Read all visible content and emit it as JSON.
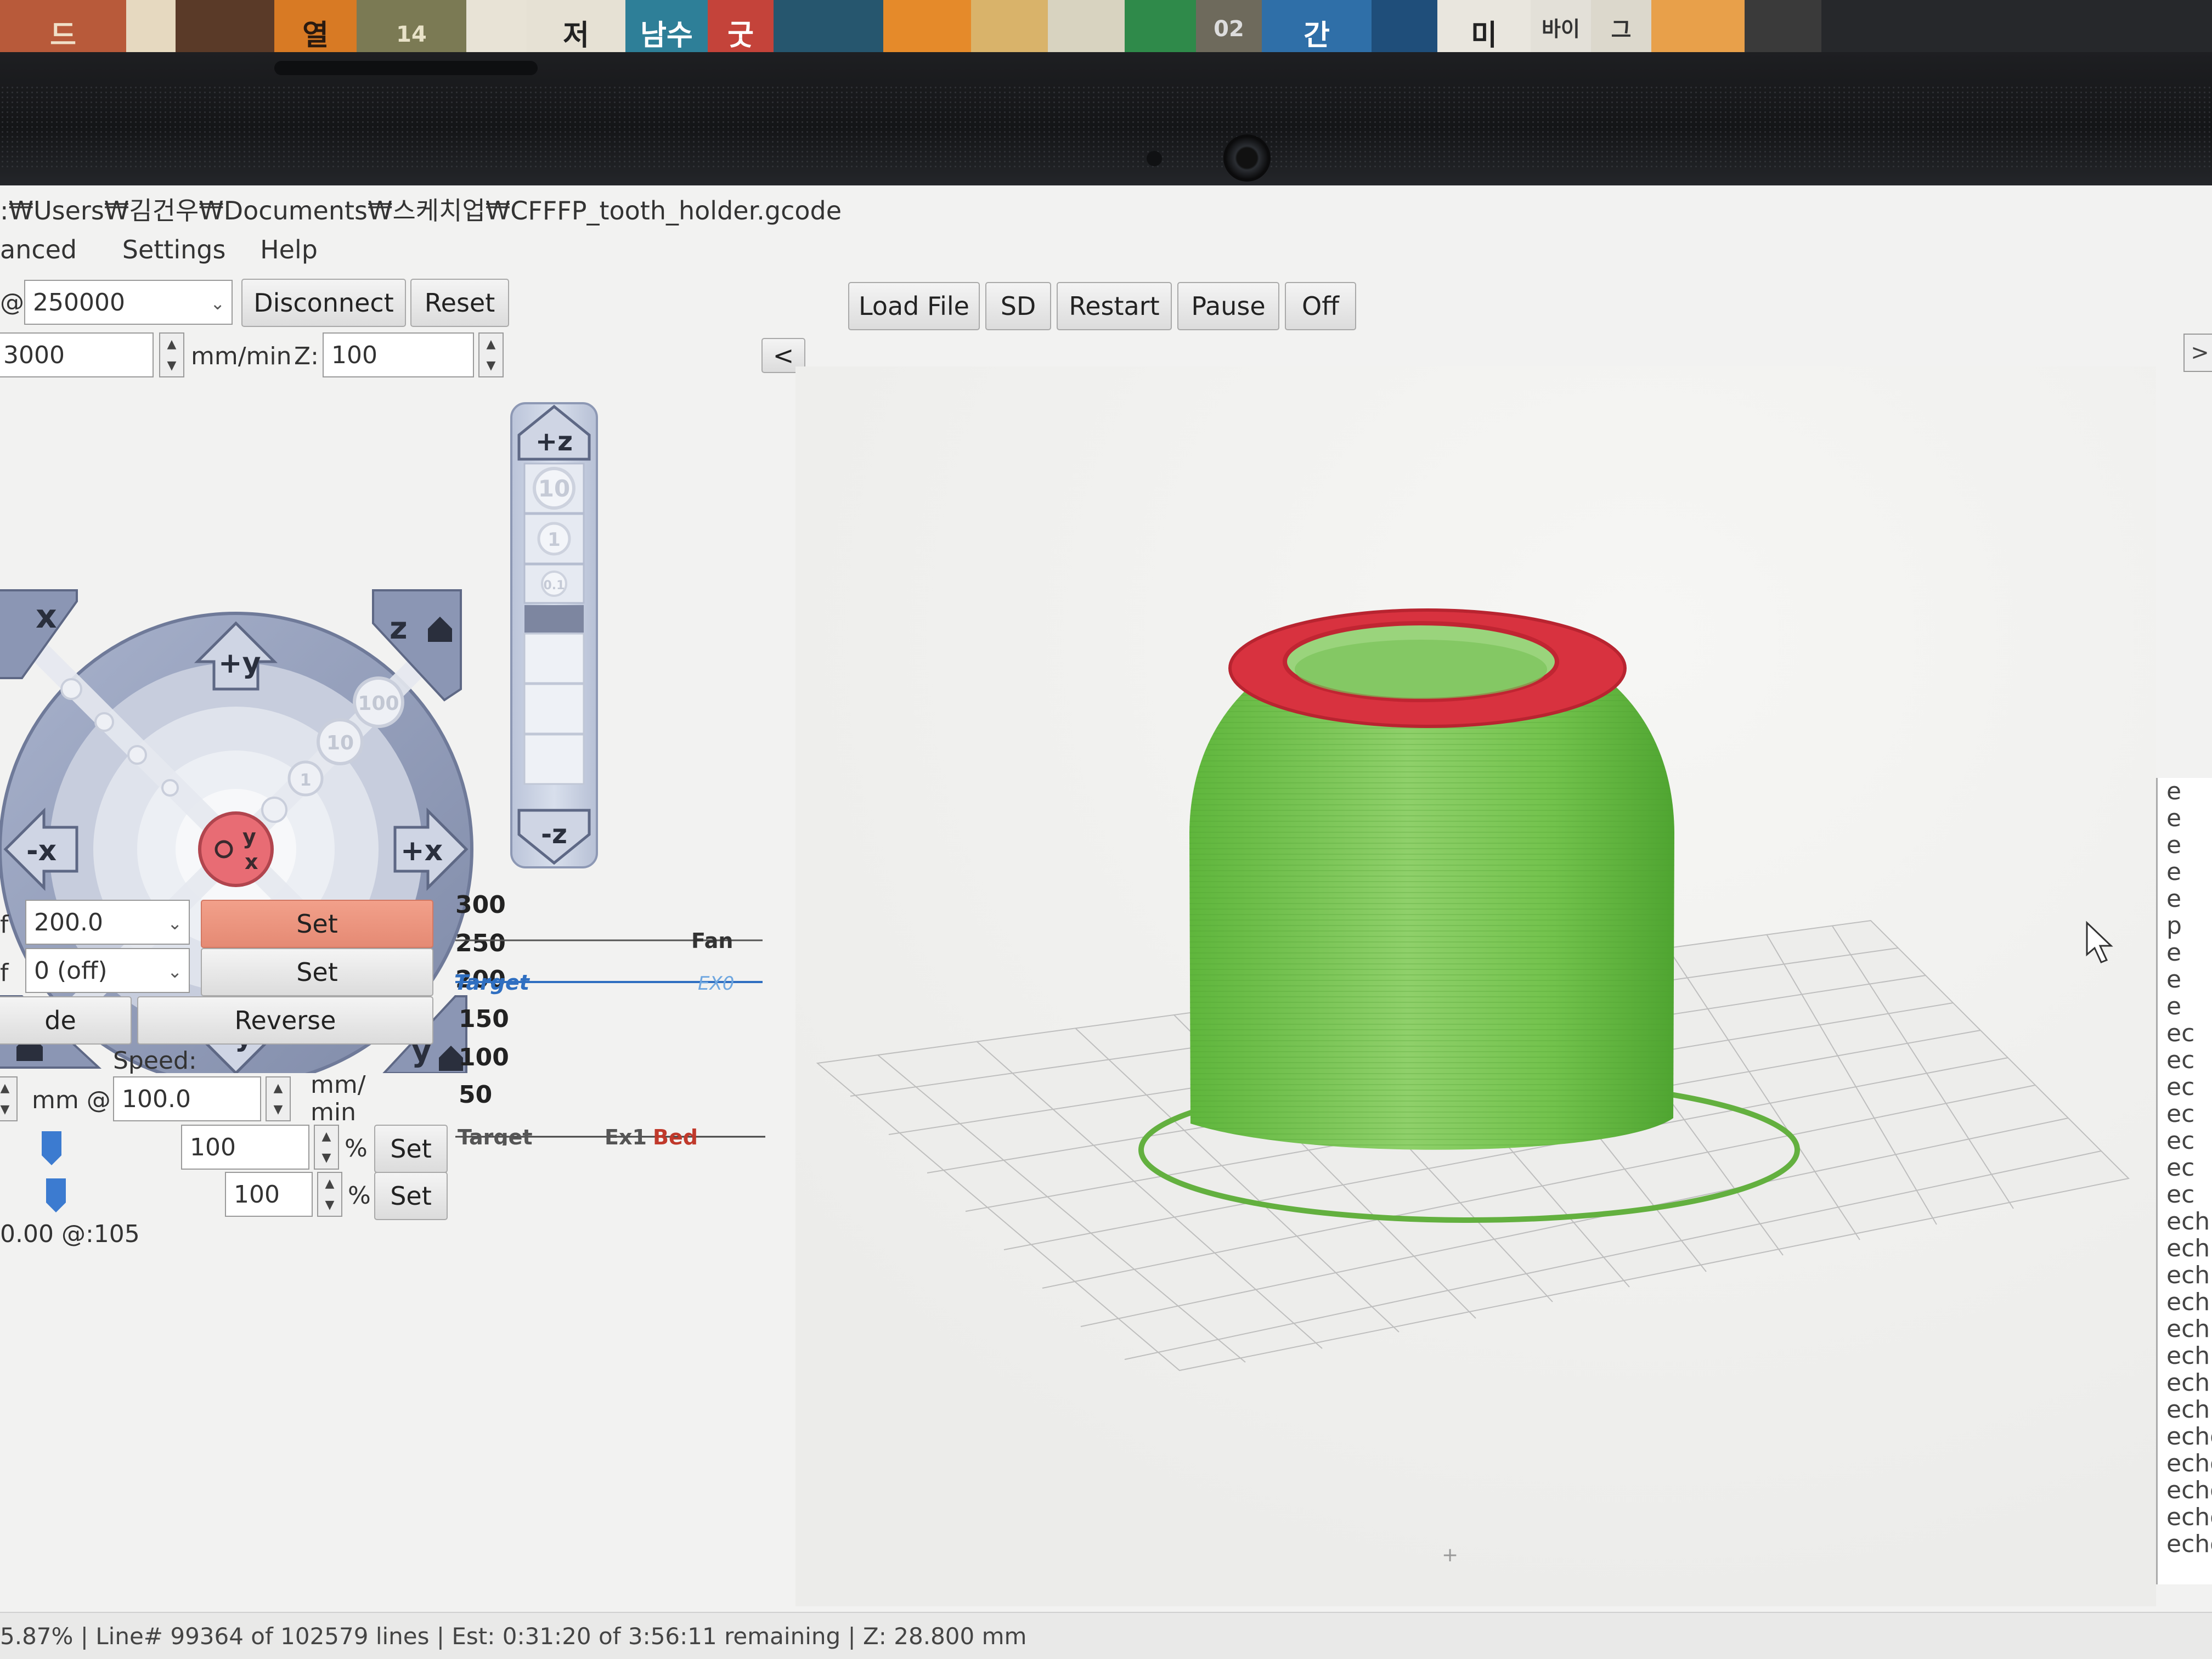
{
  "window": {
    "title_path": ":₩Users₩김건우₩Documents₩스케치업₩CFFFP_tooth_holder.gcode"
  },
  "menu": {
    "items": [
      "anced",
      "Settings",
      "Help"
    ]
  },
  "connection": {
    "baud_prefix": "@",
    "baud_value": "250000",
    "disconnect_label": "Disconnect",
    "reset_label": "Reset"
  },
  "toolbar": {
    "load_file_label": "Load File",
    "sd_label": "SD",
    "restart_label": "Restart",
    "pause_label": "Pause",
    "off_label": "Off",
    "collapse_label": "<",
    "expand_label": ">"
  },
  "feed": {
    "xy_value": "3000",
    "xy_unit": "mm/min",
    "z_label": "Z:",
    "z_value": "100"
  },
  "jog": {
    "home_x": "x",
    "home_z": "z",
    "plus_y": "+y",
    "minus_y": "-y",
    "plus_x": "+x",
    "minus_x": "-x",
    "center_y": "y",
    "center_x": "x",
    "step_100": "100",
    "step_10": "10",
    "step_1": "1",
    "home_y": "y",
    "z_plus": "+z",
    "z_minus": "-z",
    "z_step_10": "10",
    "z_step_1": "1",
    "z_step_01": "0.1"
  },
  "temps": {
    "heater_prefix": "f",
    "heater_value": "200.0",
    "heater_set": "Set",
    "bed_prefix": "f",
    "bed_value": "0 (off)",
    "bed_set": "Set"
  },
  "extrude": {
    "mode_label": "de",
    "reverse_label": "Reverse",
    "speed_label": "Speed:",
    "length_unit": "mm @",
    "speed_value": "100.0",
    "speed_unit_top": "mm/",
    "speed_unit_bottom": "min"
  },
  "overrides": {
    "feed_value": "100",
    "feed_unit": "%",
    "feed_set": "Set",
    "flow_value": "100",
    "flow_unit": "%",
    "flow_set": "Set",
    "readout": "0.00 @:105"
  },
  "graph": {
    "ticks": [
      "300",
      "250",
      "200",
      "150",
      "100",
      "50"
    ],
    "legend_fan": "Fan",
    "legend_target_top": "Target",
    "legend_ex0": "EX0",
    "legend_target_bottom": "Target",
    "legend_ex1": "Ex1",
    "legend_bed": "Bed",
    "colors": {
      "fan": "#333333",
      "ex0": "#2f6fc1",
      "bed": "#c0392b",
      "target": "#555555"
    }
  },
  "viewer": {
    "model_color": "#6cc04a",
    "top_layer_color": "#d8323f",
    "plate_label": "+"
  },
  "console": {
    "lines": [
      "e",
      "e",
      "e",
      "e",
      "e",
      "p",
      "e",
      "e",
      "e",
      "ec",
      "ec",
      "ec",
      "ec",
      "ec",
      "ec",
      "ec",
      "ech",
      "ech",
      "ech",
      "ech",
      "ech",
      "ech",
      "ech",
      "ech",
      "echo",
      "echo",
      "echo",
      "echo",
      "echo"
    ]
  },
  "status": {
    "text": "5.87% | Line# 99364 of 102579 lines | Est: 0:31:20 of 3:56:11 remaining |  Z: 28.800 mm"
  },
  "shelf": {
    "spine_texts": [
      "드",
      "열",
      "14",
      "저",
      "남수",
      "굿",
      "02",
      "간",
      "미",
      "바이",
      "그"
    ]
  }
}
